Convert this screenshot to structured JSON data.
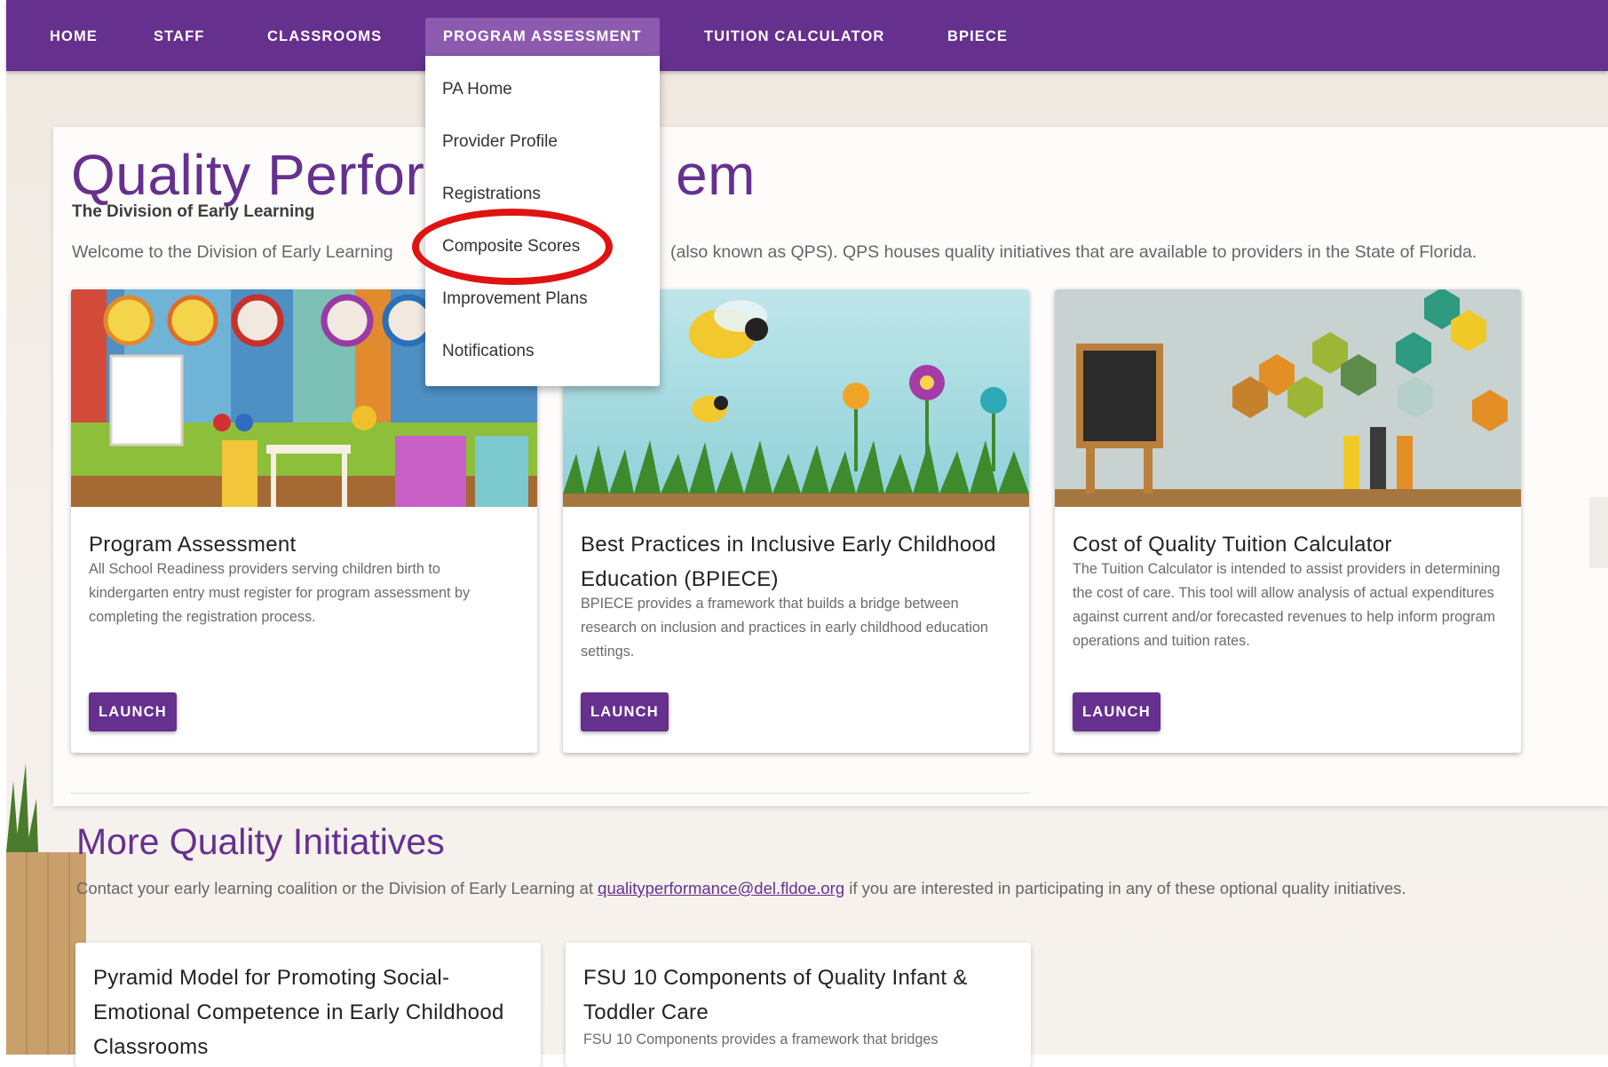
{
  "nav": {
    "items": [
      {
        "label": "HOME"
      },
      {
        "label": "STAFF"
      },
      {
        "label": "CLASSROOMS"
      },
      {
        "label": "PROGRAM ASSESSMENT"
      },
      {
        "label": "TUITION CALCULATOR"
      },
      {
        "label": "BPIECE"
      }
    ],
    "dropdown": [
      "PA Home",
      "Provider Profile",
      "Registrations",
      "Composite Scores",
      "Improvement Plans",
      "Notifications"
    ]
  },
  "hero": {
    "title_start": "Quality Perform",
    "title_end": "em",
    "subtitle": "The Division of Early Learning",
    "welcome_start": "Welcome to the Division of Early Learning",
    "welcome_end": "(also known as QPS). QPS houses quality initiatives that are available to providers in the State of Florida."
  },
  "cards": [
    {
      "title": "Program Assessment",
      "text": "All School Readiness providers serving children birth to kindergarten entry must register for program assessment by completing the registration process.",
      "button": "LAUNCH"
    },
    {
      "title": "Best Practices in Inclusive Early Childhood Education (BPIECE)",
      "text": "BPIECE provides a framework that builds a bridge between research on inclusion and practices in early childhood education settings.",
      "button": "LAUNCH"
    },
    {
      "title": "Cost of Quality Tuition Calculator",
      "text": "The Tuition Calculator is intended to assist providers in determining the cost of care. This tool will allow analysis of actual expenditures against current and/or forecasted revenues to help inform program operations and tuition rates.",
      "button": "LAUNCH"
    }
  ],
  "more": {
    "title": "More Quality Initiatives",
    "text_before": "Contact your early learning coalition or the Division of Early Learning at",
    "email": "qualityperformance@del.fldoe.org",
    "text_after": "if you are interested in participating in any of these optional quality initiatives."
  },
  "initiatives": [
    {
      "title": "Pyramid Model for Promoting Social-Emotional Competence in Early Childhood Classrooms",
      "text": ""
    },
    {
      "title": "FSU 10 Components of Quality Infant & Toddler Care",
      "text": "FSU 10 Components provides a framework that bridges"
    }
  ],
  "colors": {
    "brand": "#66308f",
    "highlight": "#e01313"
  }
}
